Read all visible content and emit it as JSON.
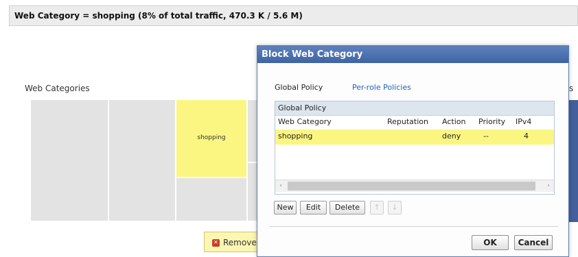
{
  "header": {
    "text": "Web Category = shopping (8% of total traffic, 470.3 K / 5.6 M)"
  },
  "section": {
    "title": "Web Categories",
    "right_fragment": "s"
  },
  "treemap": {
    "selected_label": "shopping"
  },
  "remove_button": {
    "label": "Remove"
  },
  "dialog": {
    "title": "Block Web Category",
    "tabs": [
      {
        "label": "Global Policy"
      },
      {
        "label": "Per-role Policies"
      }
    ],
    "grid": {
      "caption": "Global Policy",
      "columns": [
        "Web Category",
        "Reputation",
        "Action",
        "Priority",
        "IPv4"
      ],
      "rows": [
        {
          "web_category": "shopping",
          "reputation": "",
          "action": "deny",
          "priority": "--",
          "ipv4": "4"
        }
      ],
      "scroll_left": "‹",
      "scroll_right": "›"
    },
    "buttons": {
      "new": "New",
      "edit": "Edit",
      "delete": "Delete",
      "up": "↑",
      "down": "↓"
    },
    "ok": "OK",
    "cancel": "Cancel"
  },
  "colors": {
    "selected": "#fbf681",
    "title_bar": "#4a6fae",
    "link": "#1f5fbf"
  }
}
